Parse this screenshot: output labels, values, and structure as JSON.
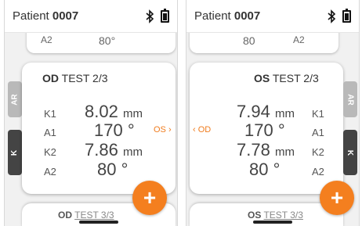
{
  "left": {
    "patient_prefix": "Patient ",
    "patient_id": "0007",
    "top_card": {
      "label": "A2",
      "value": "80°"
    },
    "card": {
      "eye": "OD",
      "test": "TEST 2/3",
      "rows": [
        {
          "label": "K1",
          "value": "8.02",
          "unit": "mm"
        },
        {
          "label": "A1",
          "value": "170 °",
          "unit": ""
        },
        {
          "label": "K2",
          "value": "7.86",
          "unit": "mm"
        },
        {
          "label": "A2",
          "value": "80 °",
          "unit": ""
        }
      ]
    },
    "nav_link": "OS ›",
    "tabs": {
      "ar": "AR",
      "k": "K"
    },
    "next_card": {
      "eye": "OD",
      "test": "TEST 3/3"
    },
    "fab": "+"
  },
  "right": {
    "patient_prefix": "Patient ",
    "patient_id": "0007",
    "top_card": {
      "label": "A2",
      "value": "80"
    },
    "card": {
      "eye": "OS",
      "test": "TEST 2/3",
      "rows": [
        {
          "label": "K1",
          "value": "7.94",
          "unit": "mm"
        },
        {
          "label": "A1",
          "value": "170 °",
          "unit": ""
        },
        {
          "label": "K2",
          "value": "7.78",
          "unit": "mm"
        },
        {
          "label": "A2",
          "value": "80 °",
          "unit": ""
        }
      ]
    },
    "nav_link": "‹ OD",
    "tabs": {
      "ar": "AR",
      "k": "K"
    },
    "next_card": {
      "eye": "OS",
      "test": "TEST 3/3"
    },
    "fab": "+"
  },
  "colors": {
    "accent": "#f47f1f",
    "tab_dark": "#444444",
    "tab_light": "#b9b9b9"
  }
}
